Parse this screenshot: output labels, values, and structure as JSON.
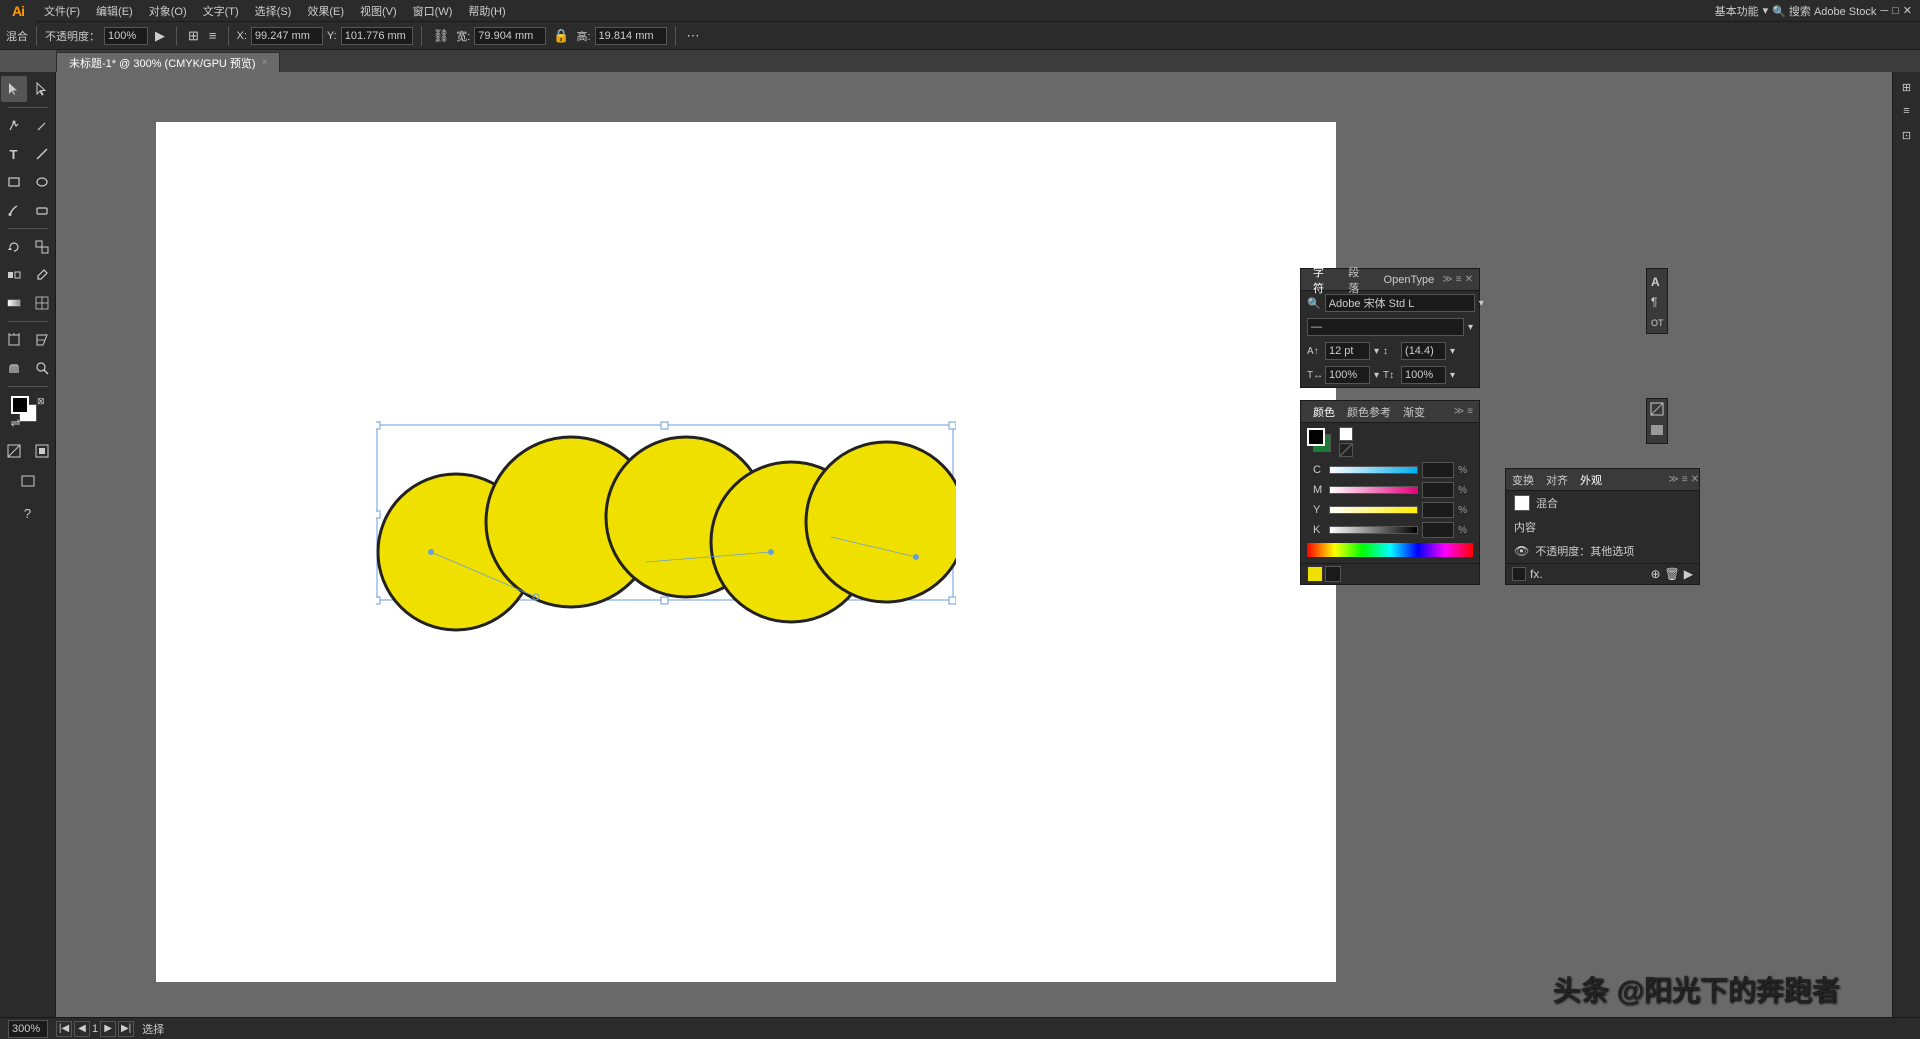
{
  "app": {
    "logo": "Ai",
    "title": "未标题-1* @ 300% (CMYK/GPU 预览)"
  },
  "menubar": {
    "items": [
      "文件(F)",
      "编辑(E)",
      "对象(O)",
      "文字(T)",
      "选择(S)",
      "效果(E)",
      "视图(V)",
      "窗口(W)",
      "帮助(H)"
    ],
    "right": "基本功能",
    "search_placeholder": "搜索 Adobe Stock"
  },
  "options_bar": {
    "blend_mode": "混合",
    "opacity_label": "不透明度：",
    "opacity_value": "100%",
    "x_label": "X:",
    "x_value": "99.247 mm",
    "y_label": "Y:",
    "y_value": "101.776 mm",
    "w_label": "宽:",
    "w_value": "79.904 mm",
    "h_label": "高:",
    "h_value": "19.814 mm"
  },
  "tab": {
    "label": "未标题-1* @ 300% (CMYK/GPU 预览)",
    "close": "×"
  },
  "panels": {
    "char_tabs": [
      "字符",
      "段落",
      "OpenType"
    ],
    "char_font": "Adobe 宋体 Std L",
    "char_size": "12 pt",
    "char_leading": "(14.4)",
    "char_scale_h": "100%",
    "char_scale_v": "100%",
    "color_tabs": [
      "颜色",
      "颜色参考",
      "渐变"
    ],
    "color_c_label": "C",
    "color_m_label": "M",
    "color_y_label": "Y",
    "color_k_label": "K",
    "transform_tabs": [
      "变换",
      "对齐",
      "外观"
    ],
    "appearance_items": [
      "混合",
      "内容",
      "不透明度：其他选项"
    ],
    "appearance_swatch_color": "#ffffff"
  },
  "status_bar": {
    "zoom": "300%",
    "mode": "选择",
    "watermark": "头条 @阳光下的奔跑者"
  },
  "tools": {
    "list": [
      "selection",
      "direct-selection",
      "pen",
      "pencil",
      "type",
      "line",
      "rectangle",
      "ellipse",
      "brush",
      "eraser",
      "rotate",
      "scale",
      "blend",
      "eyedropper",
      "gradient",
      "mesh",
      "live-paint",
      "live-paint-selection",
      "artboard",
      "slice",
      "hand",
      "zoom",
      "question"
    ]
  }
}
